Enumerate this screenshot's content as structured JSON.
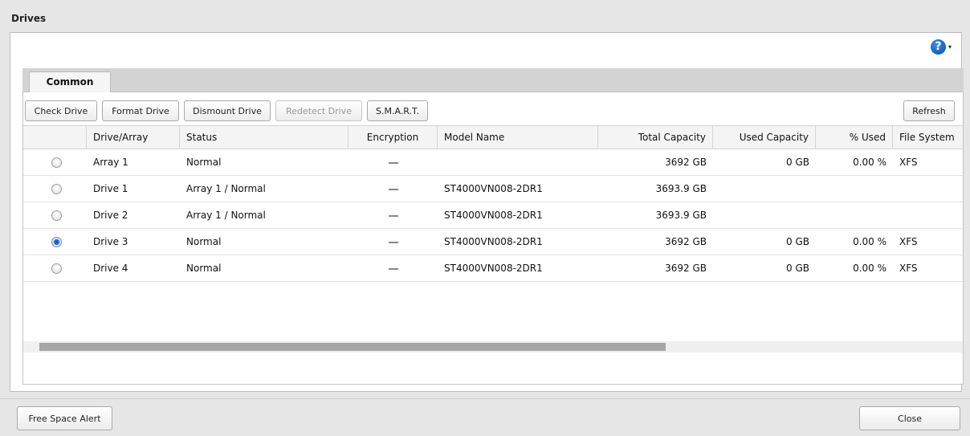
{
  "dialog": {
    "title": "Drives"
  },
  "help": {
    "icon": "help-icon",
    "label": "?",
    "caret": "▾"
  },
  "tabs": [
    {
      "label": "Common",
      "active": true
    }
  ],
  "toolbar": {
    "check_drive": "Check Drive",
    "format_drive": "Format Drive",
    "dismount_drive": "Dismount Drive",
    "redetect_drive": "Redetect Drive",
    "smart": "S.M.A.R.T.",
    "refresh": "Refresh"
  },
  "table": {
    "columns": [
      "",
      "Drive/Array",
      "Status",
      "Encryption",
      "Model Name",
      "Total Capacity",
      "Used Capacity",
      "% Used",
      "File System"
    ],
    "rows": [
      {
        "selected": false,
        "name": "Array 1",
        "status": "Normal",
        "encryption": "—",
        "model": "",
        "total": "3692 GB",
        "used": "0 GB",
        "pct": "0.00 %",
        "fs": "XFS"
      },
      {
        "selected": false,
        "name": "Drive 1",
        "status": "Array 1 / Normal",
        "encryption": "—",
        "model": "ST4000VN008-2DR1",
        "total": "3693.9 GB",
        "used": "",
        "pct": "",
        "fs": ""
      },
      {
        "selected": false,
        "name": "Drive 2",
        "status": "Array 1 / Normal",
        "encryption": "—",
        "model": "ST4000VN008-2DR1",
        "total": "3693.9 GB",
        "used": "",
        "pct": "",
        "fs": ""
      },
      {
        "selected": true,
        "name": "Drive 3",
        "status": "Normal",
        "encryption": "—",
        "model": "ST4000VN008-2DR1",
        "total": "3692 GB",
        "used": "0 GB",
        "pct": "0.00 %",
        "fs": "XFS"
      },
      {
        "selected": false,
        "name": "Drive 4",
        "status": "Normal",
        "encryption": "—",
        "model": "ST4000VN008-2DR1",
        "total": "3692 GB",
        "used": "0 GB",
        "pct": "0.00 %",
        "fs": "XFS"
      }
    ]
  },
  "footer": {
    "free_space_alert": "Free Space Alert",
    "close": "Close"
  },
  "colors": {
    "radio_selected": "#2f6cc4",
    "help_icon": "#1b5fb5",
    "scroll_thumb": "#a6a6a6"
  }
}
